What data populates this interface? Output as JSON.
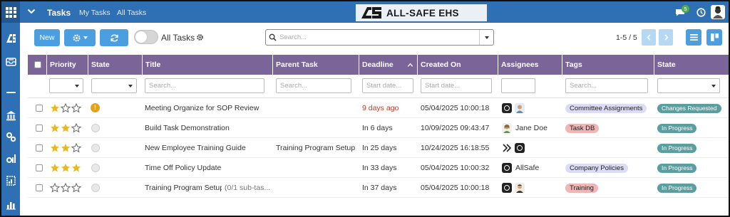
{
  "topbar": {
    "title": "Tasks",
    "links": [
      "My Tasks",
      "All Tasks"
    ],
    "brand": "ALL-SAFE EHS",
    "chat_badge": "5",
    "color": "#2f6fb4"
  },
  "toolbar": {
    "new_label": "New",
    "toggle_label": "All Tasks",
    "search_placeholder": "Search...",
    "pager": "1-5 / 5"
  },
  "columns": [
    "Priority",
    "State",
    "Title",
    "Parent Task",
    "Deadline",
    "Created On",
    "Assignees",
    "Tags",
    "State"
  ],
  "filters": {
    "title": "Search...",
    "parent": "Search...",
    "deadline": "Start date...",
    "created": "Start date...",
    "tags": "Search..."
  },
  "rows": [
    {
      "stars": 1,
      "state_icon": "warning-icon",
      "title": "Meeting Organize for SOP Review",
      "parent": "",
      "deadline": "9 days ago",
      "overdue": true,
      "created": "05/04/2025 10:00:18",
      "assignee_name": "",
      "tag": "Committee Assignments",
      "tag_color": "#dcdcf7",
      "stage": "Changes Requested"
    },
    {
      "stars": 2,
      "state_icon": "dot-icon",
      "title": "Build Task Demonstration",
      "parent": "",
      "deadline": "In 6 days",
      "overdue": false,
      "created": "10/09/2025 09:43:47",
      "assignee_name": "Jane Doe",
      "tag": "Task DB",
      "tag_color": "#f0b5b5",
      "stage": "In Progress"
    },
    {
      "stars": 2,
      "state_icon": "dot-icon",
      "title": "New Employee Training Guide",
      "parent": "Training Program Setup",
      "deadline": "In 25 days",
      "overdue": false,
      "created": "10/24/2025 16:18:55",
      "assignee_name": "",
      "tag": "",
      "tag_color": "",
      "stage": "In Progress"
    },
    {
      "stars": 3,
      "state_icon": "dot-icon",
      "title": "Time Off Policy Update",
      "parent": "",
      "deadline": "In 33 days",
      "overdue": false,
      "created": "05/04/2025 10:00:32",
      "assignee_name": "AllSafe",
      "tag": "Company Policies",
      "tag_color": "#dcdcf7",
      "stage": "In Progress"
    },
    {
      "stars": 0,
      "state_icon": "dot-icon",
      "title": "Training Program Setup",
      "subtasks": "(0/1 sub-tas...",
      "parent": "",
      "deadline": "In 37 days",
      "overdue": false,
      "created": "05/04/2025 10:00:18",
      "assignee_name": "",
      "tag": "Training",
      "tag_color": "#f0b5b5",
      "stage": "In Progress"
    }
  ]
}
